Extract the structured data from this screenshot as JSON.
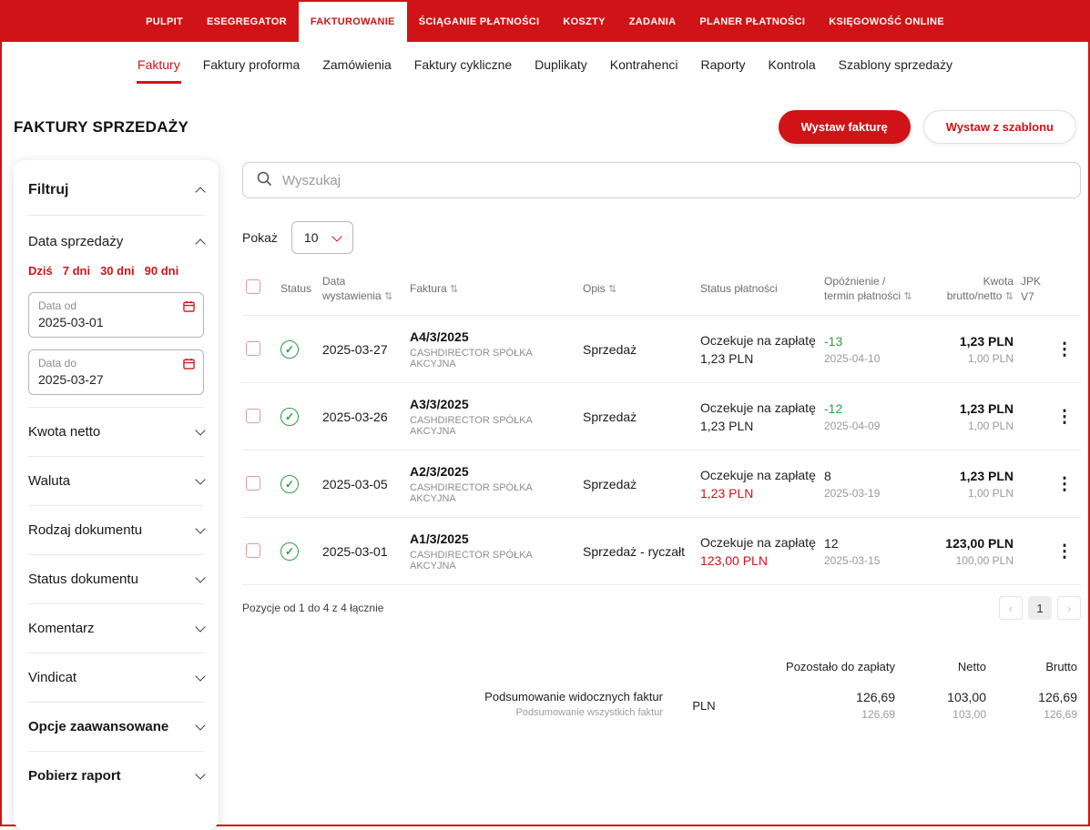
{
  "colors": {
    "accent_red": "#d01317",
    "status_green": "#2e9e44"
  },
  "top_nav": {
    "items": [
      {
        "label": "PULPIT"
      },
      {
        "label": "ESEGREGATOR"
      },
      {
        "label": "FAKTUROWANIE"
      },
      {
        "label": "ŚCIĄGANIE PŁATNOŚCI"
      },
      {
        "label": "KOSZTY"
      },
      {
        "label": "ZADANIA"
      },
      {
        "label": "PLANER PŁATNOŚCI"
      },
      {
        "label": "KSIĘGOWOŚĆ ONLINE"
      }
    ]
  },
  "sub_nav": {
    "items": [
      {
        "label": "Faktury"
      },
      {
        "label": "Faktury proforma"
      },
      {
        "label": "Zamówienia"
      },
      {
        "label": "Faktury cykliczne"
      },
      {
        "label": "Duplikaty"
      },
      {
        "label": "Kontrahenci"
      },
      {
        "label": "Raporty"
      },
      {
        "label": "Kontrola"
      },
      {
        "label": "Szablony sprzedaży"
      }
    ]
  },
  "page": {
    "title": "FAKTURY SPRZEDAŻY"
  },
  "actions": {
    "primary": "Wystaw fakturę",
    "secondary": "Wystaw z szablonu"
  },
  "sidebar": {
    "filter_title": "Filtruj",
    "date_section": {
      "title": "Data sprzedaży",
      "quick_filters": [
        "Dziś",
        "7 dni",
        "30 dni",
        "90 dni"
      ],
      "date_from_label": "Data od",
      "date_from_value": "2025-03-01",
      "date_to_label": "Data do",
      "date_to_value": "2025-03-27"
    },
    "sections": [
      "Kwota netto",
      "Waluta",
      "Rodzaj dokumentu",
      "Status dokumentu",
      "Komentarz",
      "Vindicat"
    ],
    "advanced": "Opcje zaawansowane",
    "report": "Pobierz raport"
  },
  "toolbar": {
    "search_placeholder": "Wyszukaj",
    "show_label": "Pokaż",
    "page_size": "10"
  },
  "table": {
    "headers": {
      "status": "Status",
      "date": "Data wystawienia",
      "invoice": "Faktura",
      "description": "Opis",
      "payment_status": "Status płatności",
      "delay": "Opóźnienie / termin płatności",
      "amount": "Kwota brutto/netto",
      "jpk": "JPK V7"
    },
    "rows": [
      {
        "issue_date": "2025-03-27",
        "invoice_number": "A4/3/2025",
        "contractor": "CASHDIRECTOR SPÓŁKA AKCYJNA",
        "description": "Sprzedaż",
        "payment_status": "Oczekuje na zapłatę",
        "payment_amount": "1,23 PLN",
        "delay_days": "-13",
        "due_date": "2025-04-10",
        "amount_gross": "1,23 PLN",
        "amount_net": "1,00 PLN"
      },
      {
        "issue_date": "2025-03-26",
        "invoice_number": "A3/3/2025",
        "contractor": "CASHDIRECTOR SPÓŁKA AKCYJNA",
        "description": "Sprzedaż",
        "payment_status": "Oczekuje na zapłatę",
        "payment_amount": "1,23 PLN",
        "delay_days": "-12",
        "due_date": "2025-04-09",
        "amount_gross": "1,23 PLN",
        "amount_net": "1,00 PLN"
      },
      {
        "issue_date": "2025-03-05",
        "invoice_number": "A2/3/2025",
        "contractor": "CASHDIRECTOR SPÓŁKA AKCYJNA",
        "description": "Sprzedaż",
        "payment_status": "Oczekuje na zapłatę",
        "payment_amount": "1,23 PLN",
        "delay_days": "8",
        "due_date": "2025-03-19",
        "amount_gross": "1,23 PLN",
        "amount_net": "1,00 PLN"
      },
      {
        "issue_date": "2025-03-01",
        "invoice_number": "A1/3/2025",
        "contractor": "CASHDIRECTOR SPÓŁKA AKCYJNA",
        "description": "Sprzedaż - ryczałt",
        "payment_status": "Oczekuje na zapłatę",
        "payment_amount": "123,00 PLN",
        "delay_days": "12",
        "due_date": "2025-03-15",
        "amount_gross": "123,00 PLN",
        "amount_net": "100,00 PLN"
      }
    ],
    "footer_text": "Pozycje od 1 do 4 z 4 łącznie",
    "pagination": {
      "prev_icon": "‹",
      "page": "1",
      "next_icon": "›"
    }
  },
  "summary": {
    "col_headers": [
      "Pozostało do zapłaty",
      "Netto",
      "Brutto"
    ],
    "label_visible": "Podsumowanie widocznych faktur",
    "label_all": "Podsumowanie wszystkich faktur",
    "currency": "PLN",
    "values": {
      "to_pay_visible": "126,69",
      "to_pay_all": "126,69",
      "net_visible": "103,00",
      "net_all": "103,00",
      "gross_visible": "126,69",
      "gross_all": "126,69"
    }
  },
  "icons": {
    "kebab": "⋮",
    "check": "✓",
    "sort": "⇅"
  }
}
